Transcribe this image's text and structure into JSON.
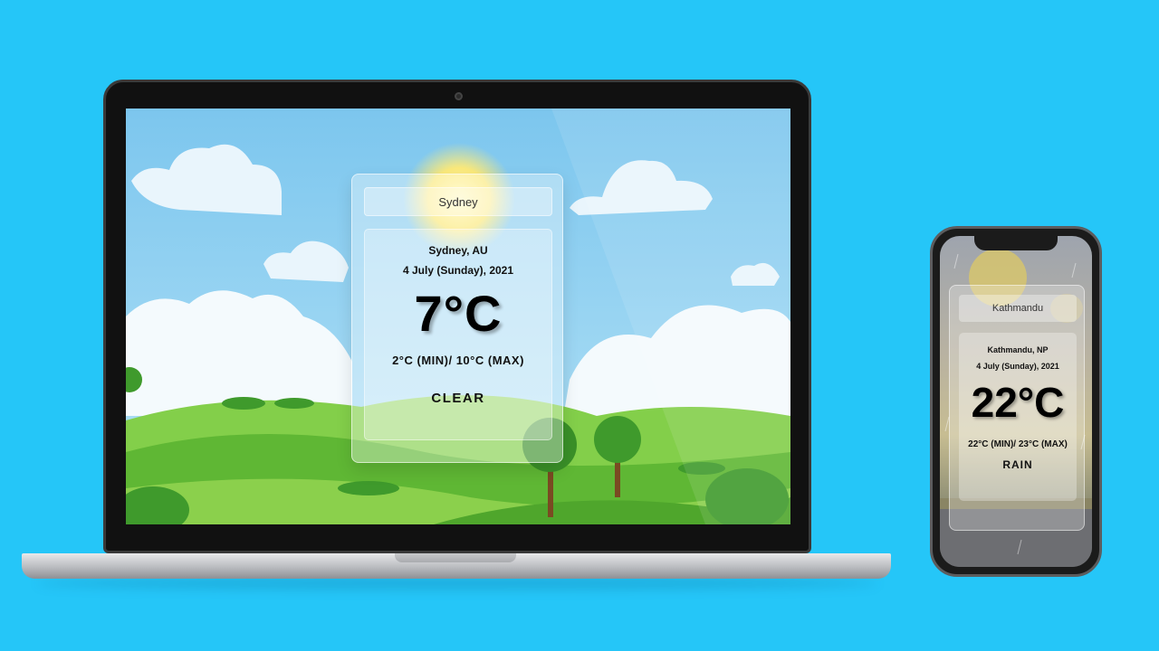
{
  "desktop": {
    "search": {
      "value": "Sydney"
    },
    "weather": {
      "location": "Sydney, AU",
      "date": "4 July (Sunday), 2021",
      "temperature": "7°C",
      "min_max": "2°C (MIN)/ 10°C (MAX)",
      "condition": "CLEAR"
    }
  },
  "mobile": {
    "search": {
      "value": "Kathmandu"
    },
    "weather": {
      "location": "Kathmandu, NP",
      "date": "4 July (Sunday), 2021",
      "temperature": "22°C",
      "min_max": "22°C (MIN)/ 23°C (MAX)",
      "condition": "RAIN"
    }
  },
  "colors": {
    "page_background": "#25c6f8",
    "sky": "#8fd0ef",
    "grass": "#6cc43d"
  }
}
